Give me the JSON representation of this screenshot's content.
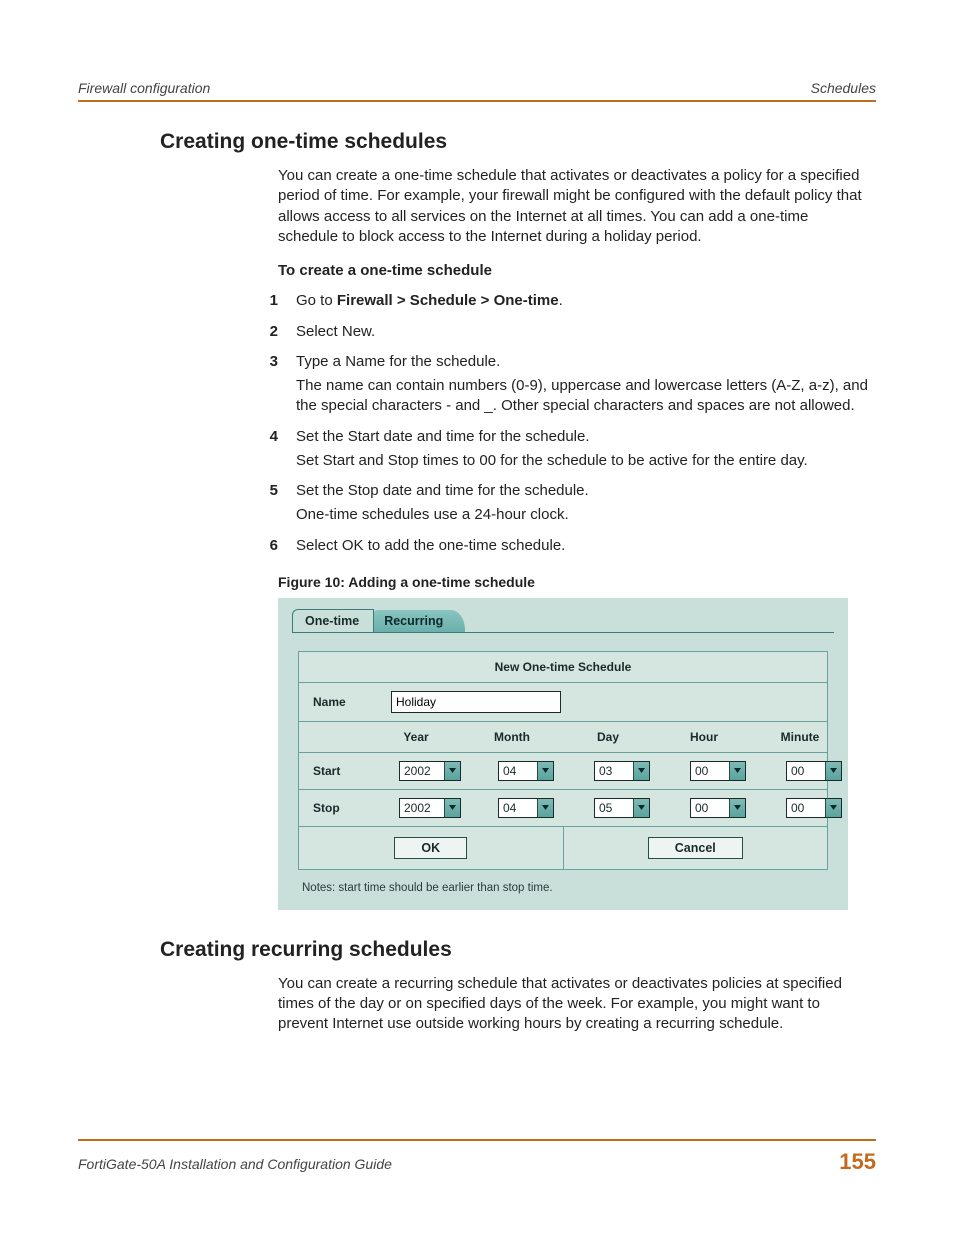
{
  "header": {
    "left": "Firewall configuration",
    "right": "Schedules"
  },
  "section1": {
    "title": "Creating one-time schedules",
    "intro": "You can create a one-time schedule that activates or deactivates a policy for a specified period of time. For example, your firewall might be configured with the default policy that allows access to all services on the Internet at all times. You can add a one-time schedule to block access to the Internet during a holiday period.",
    "sub": "To create a one-time schedule",
    "steps": [
      {
        "n": "1",
        "pre": "Go to ",
        "bold": "Firewall > Schedule > One-time",
        "post": "."
      },
      {
        "n": "2",
        "text": "Select New."
      },
      {
        "n": "3",
        "text": "Type a Name for the schedule.",
        "sub": "The name can contain numbers (0-9), uppercase and lowercase letters (A-Z, a-z), and the special characters - and _. Other special characters and spaces are not allowed."
      },
      {
        "n": "4",
        "text": "Set the Start date and time for the schedule.",
        "sub": "Set Start and Stop times to 00 for the schedule to be active for the entire day."
      },
      {
        "n": "5",
        "text": "Set the Stop date and time for the schedule.",
        "sub": "One-time schedules use a 24-hour clock."
      },
      {
        "n": "6",
        "text": "Select OK to add the one-time schedule."
      }
    ],
    "fig_caption": "Figure 10: Adding a one-time schedule"
  },
  "figure": {
    "tabs": {
      "active": "One-time",
      "inactive": "Recurring"
    },
    "panel_title": "New One-time Schedule",
    "name_label": "Name",
    "name_value": "Holiday",
    "cols": {
      "year": "Year",
      "month": "Month",
      "day": "Day",
      "hour": "Hour",
      "minute": "Minute"
    },
    "rows": {
      "start_label": "Start",
      "stop_label": "Stop",
      "start": {
        "year": "2002",
        "month": "04",
        "day": "03",
        "hour": "00",
        "minute": "00"
      },
      "stop": {
        "year": "2002",
        "month": "04",
        "day": "05",
        "hour": "00",
        "minute": "00"
      }
    },
    "ok": "OK",
    "cancel": "Cancel",
    "notes": "Notes: start time should be earlier than stop time."
  },
  "section2": {
    "title": "Creating recurring schedules",
    "intro": "You can create a recurring schedule that activates or deactivates policies at specified times of the day or on specified days of the week. For example, you might want to prevent Internet use outside working hours by creating a recurring schedule."
  },
  "footer": {
    "left": "FortiGate-50A Installation and Configuration Guide",
    "page": "155"
  }
}
